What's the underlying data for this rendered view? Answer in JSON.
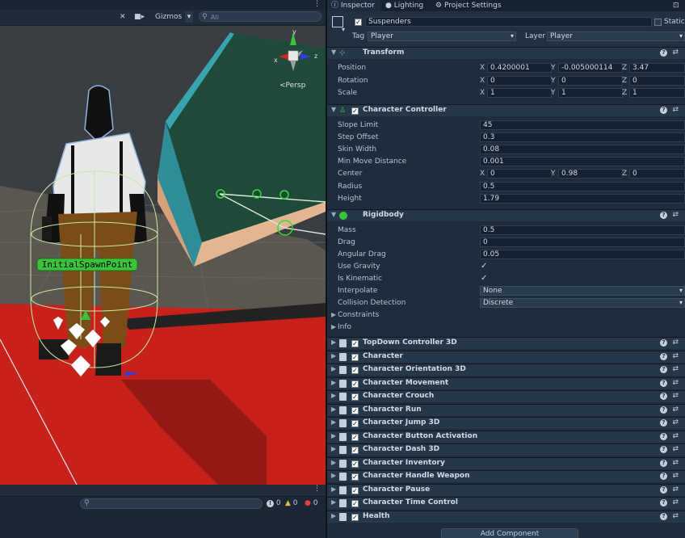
{
  "scene": {
    "gizmos_label": "Gizmos",
    "search_placeholder": "All",
    "persp_label": "<Persp",
    "axis_labels": {
      "x": "x",
      "y": "y",
      "z": "z"
    },
    "spawn_label": "InitialSpawnPoint",
    "console_counts": {
      "info": "0",
      "warn": "0",
      "error": "0"
    }
  },
  "tabs": [
    {
      "label": "Inspector",
      "icon": "info-icon"
    },
    {
      "label": "Lighting",
      "icon": "bulb-icon"
    },
    {
      "label": "Project Settings",
      "icon": "gear-icon"
    }
  ],
  "gameobject": {
    "name": "Suspenders",
    "static_label": "Static",
    "tag_label": "Tag",
    "tag_value": "Player",
    "layer_label": "Layer",
    "layer_value": "Player"
  },
  "transform": {
    "title": "Transform",
    "position_label": "Position",
    "rotation_label": "Rotation",
    "scale_label": "Scale",
    "position": {
      "x": "0.4200001",
      "y": "-0.005000114",
      "z": "3.47"
    },
    "rotation": {
      "x": "0",
      "y": "0",
      "z": "0"
    },
    "scale": {
      "x": "1",
      "y": "1",
      "z": "1"
    }
  },
  "character_controller": {
    "title": "Character Controller",
    "slope_limit_label": "Slope Limit",
    "slope_limit": "45",
    "step_offset_label": "Step Offset",
    "step_offset": "0.3",
    "skin_width_label": "Skin Width",
    "skin_width": "0.08",
    "min_move_label": "Min Move Distance",
    "min_move": "0.001",
    "center_label": "Center",
    "center": {
      "x": "0",
      "y": "0.98",
      "z": "0"
    },
    "radius_label": "Radius",
    "radius": "0.5",
    "height_label": "Height",
    "height": "1.79"
  },
  "rigidbody": {
    "title": "Rigidbody",
    "mass_label": "Mass",
    "mass": "0.5",
    "drag_label": "Drag",
    "drag": "0",
    "angular_drag_label": "Angular Drag",
    "angular_drag": "0.05",
    "use_gravity_label": "Use Gravity",
    "is_kinematic_label": "Is Kinematic",
    "interpolate_label": "Interpolate",
    "interpolate": "None",
    "collision_label": "Collision Detection",
    "collision": "Discrete",
    "constraints_label": "Constraints",
    "info_label": "Info"
  },
  "scripts": [
    "TopDown Controller 3D",
    "Character",
    "Character Orientation 3D",
    "Character Movement",
    "Character Crouch",
    "Character Run",
    "Character Jump 3D",
    "Character Button Activation",
    "Character Dash 3D",
    "Character Inventory",
    "Character Handle Weapon",
    "Character Pause",
    "Character Time Control",
    "Health"
  ],
  "add_component_label": "Add Component",
  "axis": {
    "x": "X",
    "y": "Y",
    "z": "Z"
  },
  "colors": {
    "panel": "#1f2c3b",
    "header": "#26374a",
    "field": "#152130",
    "accent_green": "#3ac43a",
    "floor_red": "#c8211b"
  }
}
